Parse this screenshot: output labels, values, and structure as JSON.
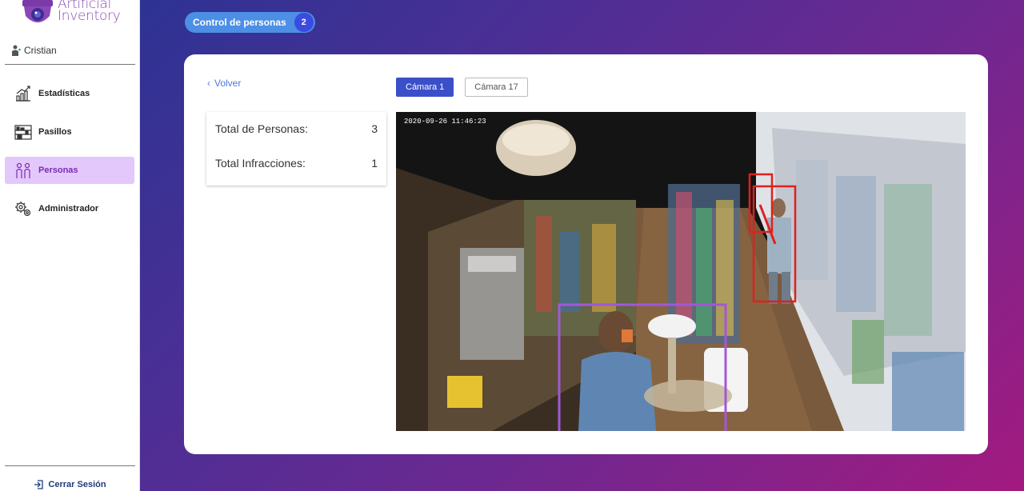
{
  "sidebar": {
    "brand_line1": "Artificial",
    "brand_line2": "Inventory",
    "user_name": "Cristian",
    "items": [
      {
        "label": "Estadísticas",
        "icon": "chart-growth-icon",
        "active": false
      },
      {
        "label": "Pasillos",
        "icon": "shelf-icon",
        "active": false
      },
      {
        "label": "Personas",
        "icon": "people-icon",
        "active": true
      },
      {
        "label": "Administrador",
        "icon": "gears-icon",
        "active": false
      }
    ],
    "logout_label": "Cerrar Sesión"
  },
  "header": {
    "section_label": "Control de personas",
    "count": "2"
  },
  "content": {
    "back_label": "Volver",
    "stats": [
      {
        "label": "Total de Personas:",
        "value": "3"
      },
      {
        "label": "Total Infracciones:",
        "value": "1"
      }
    ],
    "cameras": [
      {
        "label": "Cámara 1",
        "selected": true
      },
      {
        "label": "Cámara 17",
        "selected": false
      }
    ],
    "feed_timestamp": "2020-09-26  11:46:23",
    "detections": [
      {
        "color": "#e0201e",
        "kind": "infraction"
      },
      {
        "color": "#e0201e",
        "kind": "infraction"
      },
      {
        "color": "#a158d8",
        "kind": "person"
      }
    ]
  },
  "colors": {
    "accent": "#3a4fc9",
    "active_nav_bg": "#e3c8fb",
    "pill_bg": "#4d8fe4",
    "back_link": "#4d78d8"
  }
}
